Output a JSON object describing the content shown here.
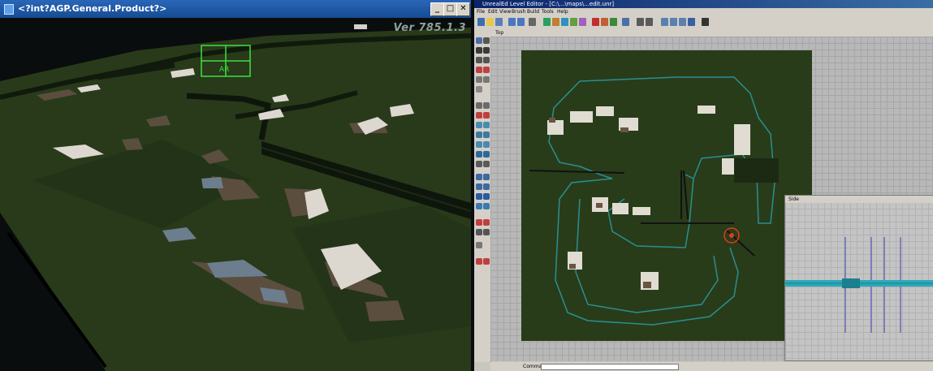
{
  "game_window": {
    "title": "<?int?AGP.General.Product?>",
    "version_text": "Ver 785.1.3",
    "minimize_label": "_",
    "maximize_label": "□",
    "close_label": "✕"
  },
  "editor": {
    "title": "UnrealEd Level Editor - [C:\\...\\maps\\...edit.unr]",
    "menu": [
      "File",
      "Edit",
      "View",
      "Brush",
      "Build",
      "Tools",
      "Help"
    ],
    "top_viewport_label": "Top",
    "side_viewport_label": "Side",
    "command_label": "Command"
  },
  "colors": {
    "titlebar": "#164c94",
    "terrain": "#283a1a",
    "bsp_outline": "#2a8f8f",
    "selection_green": "#3ee03e",
    "actor_marker": "#e23a1a"
  }
}
